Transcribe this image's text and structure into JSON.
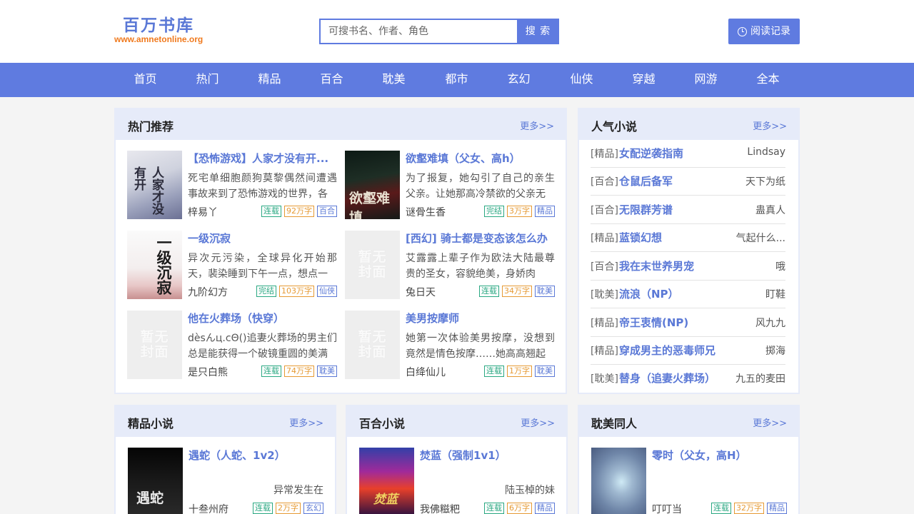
{
  "site": {
    "name": "百万书库",
    "url": "www.amnetonline.org"
  },
  "search": {
    "placeholder": "可搜书名、作者、角色",
    "button": "搜 索"
  },
  "history_button": "阅读记录",
  "nav": [
    "首页",
    "热门",
    "精品",
    "百合",
    "耽美",
    "都市",
    "玄幻",
    "仙侠",
    "穿越",
    "网游",
    "全本"
  ],
  "hot": {
    "title": "热门推荐",
    "more": "更多>>",
    "books": [
      {
        "title": "【恐怖游戏】人家才没有开...",
        "desc": "死宅单细胞颜狗莫黎偶然间遭遇事故来到了恐怖游戏的世界，各",
        "author": "梓易丫",
        "status": "连载",
        "words": "92万字",
        "category": "百合",
        "cover_text": "人家才没有开"
      },
      {
        "title": "欲壑难填（父女、高h）",
        "desc": "为了报复，她勾引了自己的亲生父亲。让她那高冷禁欲的父亲无",
        "author": "谜骨生香",
        "status": "完结",
        "words": "3万字",
        "category": "精品",
        "cover_text": "欲壑难填"
      },
      {
        "title": "一级沉寂",
        "desc": "异次元污染，全球异化开始那天，裴染睡到下午一点，想点一",
        "author": "九阶幻方",
        "status": "完结",
        "words": "103万字",
        "category": "仙侠",
        "cover_text": "一级沉寂"
      },
      {
        "title": "[西幻] 骑士都是变态该怎么办",
        "desc": "艾露露上辈子作为欧法大陆最尊贵的圣女，容貌绝美，身娇肉",
        "author": "兔日天",
        "status": "连载",
        "words": "34万字",
        "category": "耽美",
        "cover_text": "暂无封面"
      },
      {
        "title": "他在火葬场（快穿）",
        "desc": "dèsんц.cΘ()追妻火葬场的男主们总是能获得一个破镜重圆的美满",
        "author": "是只白熊",
        "status": "连载",
        "words": "74万字",
        "category": "耽美",
        "cover_text": "暂无封面"
      },
      {
        "title": "美男按摩师",
        "desc": "她第一次体验美男按摩，没想到竟然是情色按摩……她高高翘起",
        "author": "白绛仙儿",
        "status": "连载",
        "words": "1万字",
        "category": "耽美",
        "cover_text": "暂无封面"
      }
    ]
  },
  "popular": {
    "title": "人气小说",
    "more": "更多>>",
    "items": [
      {
        "category": "[精品]",
        "name": "女配逆袭指南",
        "author": "Lindsay"
      },
      {
        "category": "[百合]",
        "name": "仓鼠后备军",
        "author": "天下为纸"
      },
      {
        "category": "[百合]",
        "name": "无限群芳谱",
        "author": "蛊真人"
      },
      {
        "category": "[精品]",
        "name": "蓝锁幻想",
        "author": "气起什么..."
      },
      {
        "category": "[百合]",
        "name": "我在末世养男宠",
        "author": "哦"
      },
      {
        "category": "[耽美]",
        "name": "流浪（NP）",
        "author": "盯鞋"
      },
      {
        "category": "[精品]",
        "name": "帝王衷情(NP)",
        "author": "风九九"
      },
      {
        "category": "[精品]",
        "name": "穿成男主的恶毒师兄",
        "author": "掷海"
      },
      {
        "category": "[耽美]",
        "name": "替身（追妻火葬场）",
        "author": "九五的麦田"
      }
    ]
  },
  "sections": [
    {
      "title": "精品小说",
      "more": "更多>>",
      "book": {
        "title": "遇蛇（人蛇、1v2）",
        "desc": "异常发生在",
        "author": "十叁州府",
        "status": "连载",
        "words": "2万字",
        "category": "玄幻",
        "cover_text": "遇蛇"
      }
    },
    {
      "title": "百合小说",
      "more": "更多>>",
      "book": {
        "title": "焚蓝（强制1v1）",
        "desc": "陆玉棹的妹",
        "author": "我佛糍粑",
        "status": "连载",
        "words": "6万字",
        "category": "精品",
        "cover_text": "焚蓝"
      }
    },
    {
      "title": "耽美同人",
      "more": "更多>>",
      "book": {
        "title": "零时（父女，高H）",
        "desc": "",
        "author": "叮叮当",
        "status": "连载",
        "words": "32万字",
        "category": "精品",
        "cover_text": ""
      }
    }
  ],
  "colors": {
    "accent": "#5f7be0",
    "link": "#5a78d6",
    "logo_url": "#f07a1e",
    "panel_head": "#e6ebf9",
    "tag_status": "#2aa882",
    "tag_words": "#e69a34"
  }
}
